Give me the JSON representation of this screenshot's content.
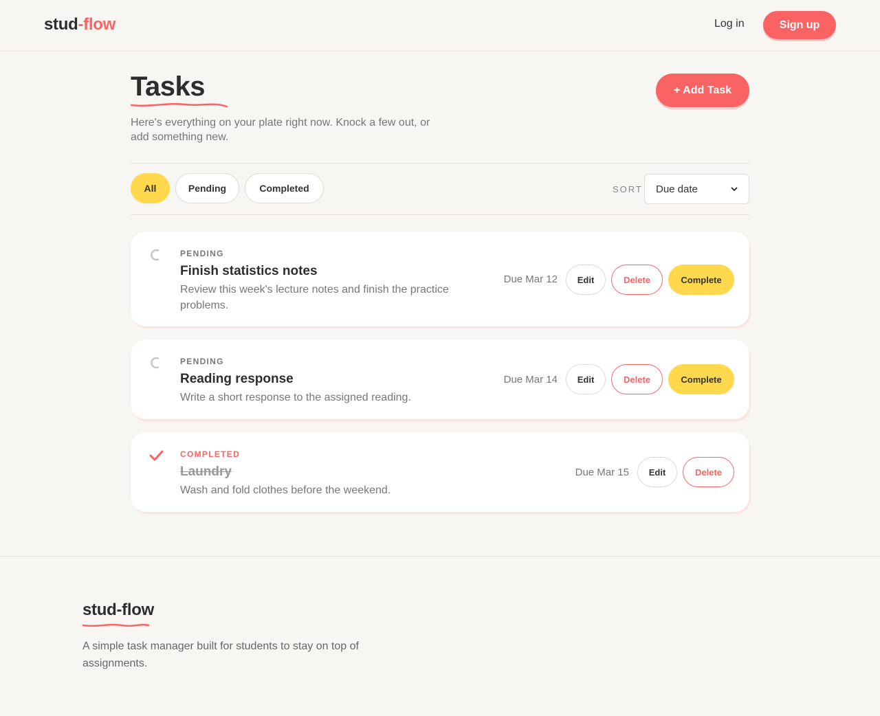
{
  "header": {
    "brand_part1": "stud",
    "brand_part2": "-flow",
    "login_label": "Log in",
    "signup_label": "Sign up"
  },
  "page": {
    "title": "Tasks",
    "subtitle": "Here's everything on your plate right now. Knock a few out, or add something new.",
    "add_task_label": "+ Add Task"
  },
  "filters": {
    "items": [
      {
        "label": "All",
        "active": true
      },
      {
        "label": "Pending",
        "active": false
      },
      {
        "label": "Completed",
        "active": false
      }
    ],
    "sort_label": "SORT",
    "sort_value": "Due date"
  },
  "tasks": [
    {
      "status": "PENDING",
      "title": "Finish statistics notes",
      "description": "Review this week's lecture notes and finish the practice problems.",
      "due": "Due Mar 12",
      "edit_label": "Edit",
      "delete_label": "Delete",
      "complete_label": "Complete"
    },
    {
      "status": "PENDING",
      "title": "Reading response",
      "description": "Write a short response to the assigned reading.",
      "due": "Due Mar 14",
      "edit_label": "Edit",
      "delete_label": "Delete",
      "complete_label": "Complete"
    },
    {
      "status": "COMPLETED",
      "title": "Laundry",
      "description": "Wash and fold clothes before the weekend.",
      "due": "Due Mar 15",
      "edit_label": "Edit",
      "delete_label": "Delete"
    }
  ],
  "footer": {
    "brand": "stud-flow",
    "tagline": "A simple task manager built for students to stay on top of assignments."
  },
  "colors": {
    "accent": "#fa6363",
    "highlight": "#ffd84d",
    "background": "#f8f6f2"
  },
  "icons": {
    "pending": "pending-spinner-icon",
    "completed": "checkmark-icon",
    "sort": "chevron-down-icon"
  }
}
